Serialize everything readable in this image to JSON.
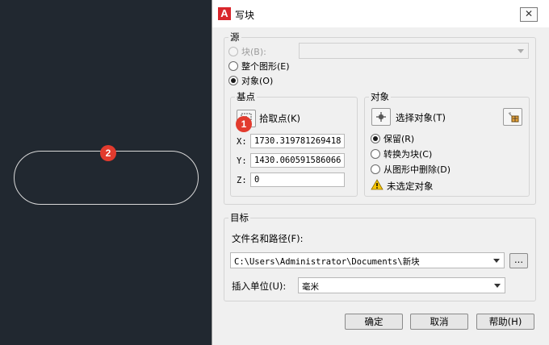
{
  "dialog": {
    "title": "写块",
    "close_label": "✕"
  },
  "source": {
    "title": "源",
    "block_label": "块(B):",
    "entire_drawing_label": "整个图形(E)",
    "objects_label": "对象(O)",
    "block_combo_value": ""
  },
  "base_point": {
    "title": "基点",
    "pick_point_label": "拾取点(K)",
    "x_label": "X:",
    "x_value": "1730.319781269418",
    "y_label": "Y:",
    "y_value": "1430.060591586066",
    "z_label": "Z:",
    "z_value": "0"
  },
  "objects": {
    "title": "对象",
    "select_objects_label": "选择对象(T)",
    "retain_label": "保留(R)",
    "convert_label": "转换为块(C)",
    "delete_label": "从图形中删除(D)",
    "warning_text": "未选定对象"
  },
  "destination": {
    "title": "目标",
    "path_label": "文件名和路径(F):",
    "path_value": "C:\\Users\\Administrator\\Documents\\新块",
    "browse_label": "...",
    "units_label": "插入单位(U):",
    "units_value": "毫米"
  },
  "buttons": {
    "ok": "确定",
    "cancel": "取消",
    "help": "帮助(H)"
  },
  "badges": {
    "one": "1",
    "two": "2"
  },
  "colors": {
    "canvas_bg": "#212830",
    "badge": "#e23b2e",
    "autocad_red": "#d9262c"
  }
}
